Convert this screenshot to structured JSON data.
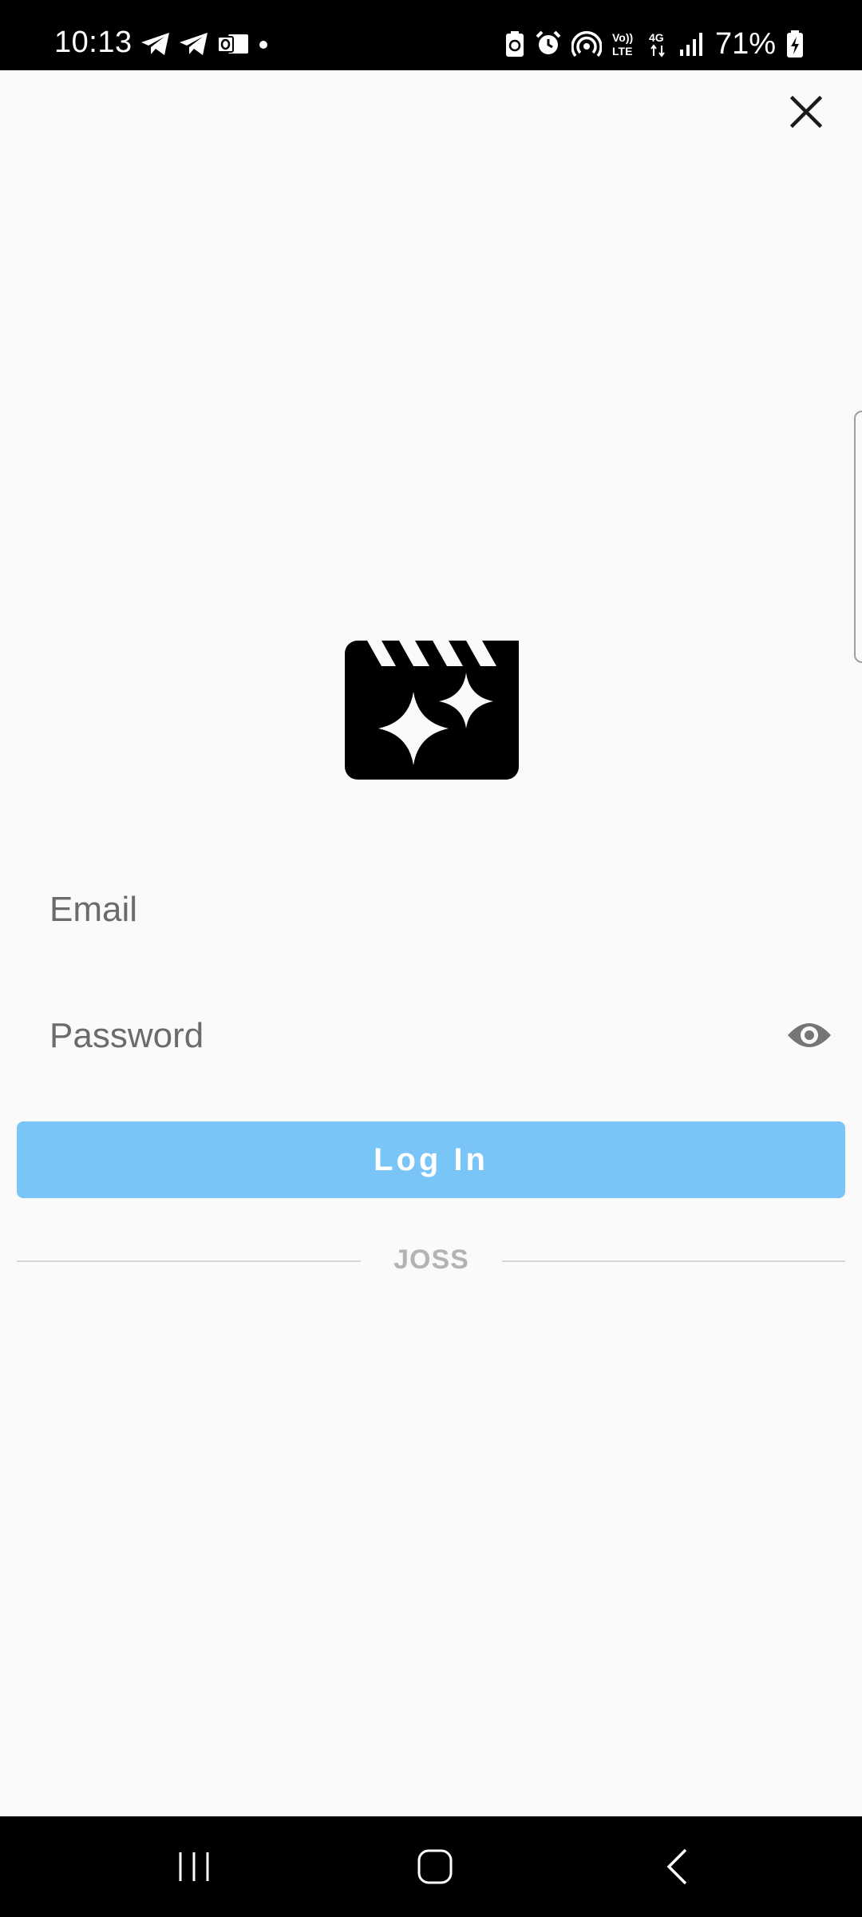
{
  "status_bar": {
    "time": "10:13",
    "battery_percent": "71%",
    "left_icons": [
      "telegram-icon",
      "telegram-icon",
      "outlook-icon",
      "notification-dot-icon"
    ],
    "right_icons": [
      "battery-saver-icon",
      "alarm-icon",
      "hotspot-icon",
      "volte-icon",
      "4g-icon",
      "signal-icon",
      "battery-charging-icon"
    ]
  },
  "header": {
    "close_icon": "close-icon"
  },
  "logo": {
    "icon": "movie-sparkle-icon"
  },
  "form": {
    "email_placeholder": "Email",
    "email_value": "",
    "password_placeholder": "Password",
    "password_value": "",
    "password_toggle_icon": "eye-icon",
    "login_label": "Log In"
  },
  "divider": {
    "label": "JOSS"
  },
  "nav_bar": {
    "items": [
      "recents-icon",
      "home-icon",
      "back-icon"
    ]
  },
  "colors": {
    "background": "#fafafa",
    "login_button": "#79c5f7",
    "login_text": "#ffffff",
    "divider_text": "#b3b3b3",
    "system_bars": "#000000"
  }
}
